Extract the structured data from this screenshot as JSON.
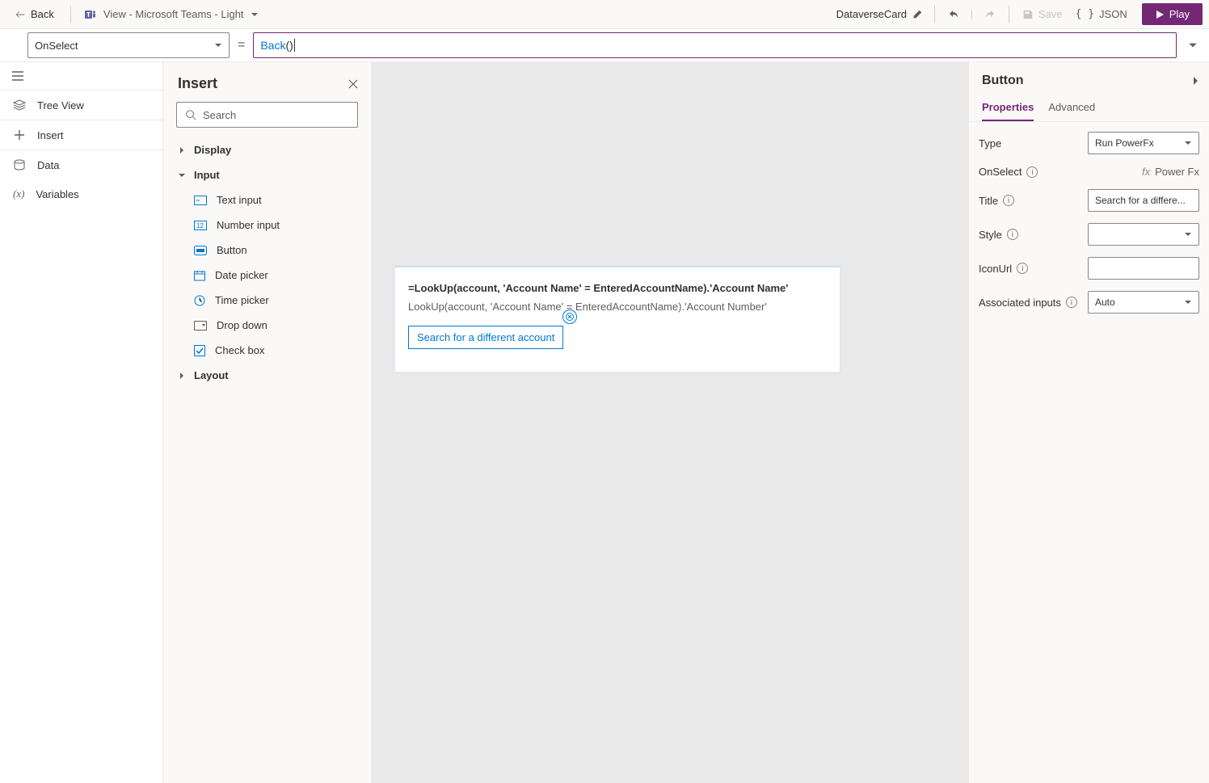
{
  "topbar": {
    "back": "Back",
    "view_label": "View - Microsoft Teams - Light",
    "card_name": "DataverseCard",
    "save": "Save",
    "json": "JSON",
    "play": "Play"
  },
  "formula": {
    "property": "OnSelect",
    "fn": "Back",
    "args": "()"
  },
  "rail": {
    "tree_view": "Tree View",
    "insert": "Insert",
    "data": "Data",
    "variables": "Variables"
  },
  "insert_panel": {
    "title": "Insert",
    "search_placeholder": "Search",
    "cat_display": "Display",
    "cat_input": "Input",
    "cat_layout": "Layout",
    "items": {
      "text_input": "Text input",
      "number_input": "Number input",
      "button": "Button",
      "date_picker": "Date picker",
      "time_picker": "Time picker",
      "drop_down": "Drop down",
      "check_box": "Check box"
    }
  },
  "canvas": {
    "title": "=LookUp(account, 'Account Name' = EnteredAccountName).'Account Name'",
    "subtitle": "LookUp(account, 'Account Name' = EnteredAccountName).'Account Number'",
    "button_label": "Search for a different account"
  },
  "props": {
    "title": "Button",
    "tab_properties": "Properties",
    "tab_advanced": "Advanced",
    "rows": {
      "type": "Type",
      "type_value": "Run PowerFx",
      "onselect": "OnSelect",
      "onselect_value": "Power Fx",
      "title_label": "Title",
      "title_value": "Search for a differe...",
      "style": "Style",
      "style_value": "",
      "iconurl": "IconUrl",
      "iconurl_value": "",
      "associated": "Associated inputs",
      "associated_value": "Auto"
    }
  }
}
